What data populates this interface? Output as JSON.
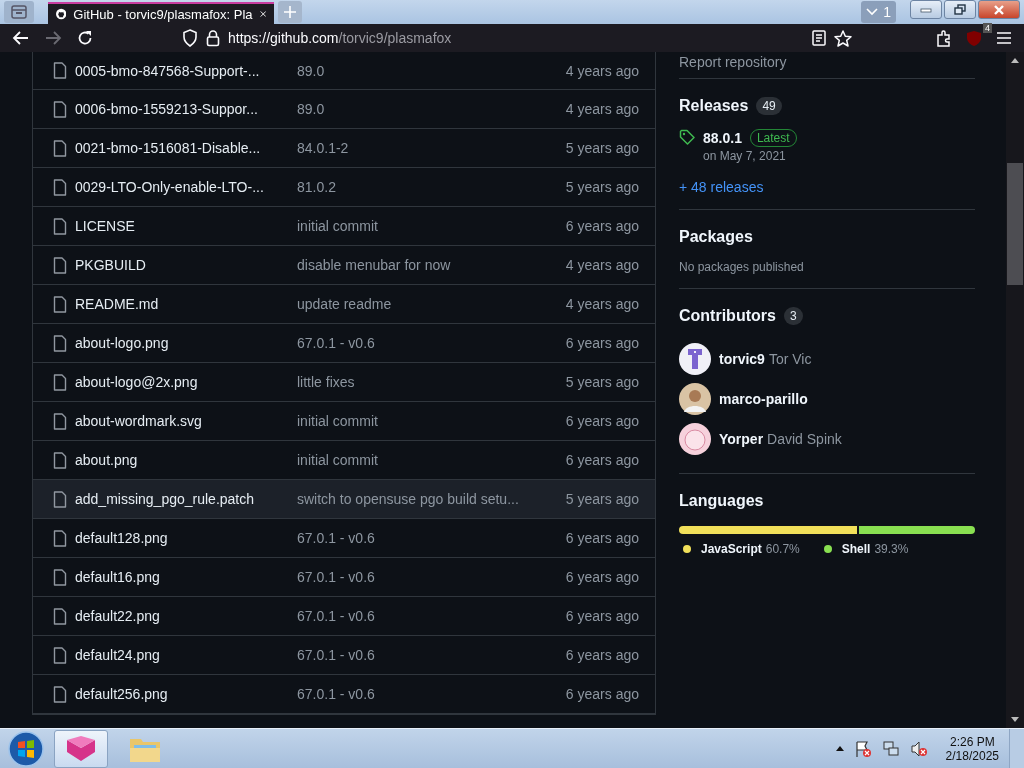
{
  "browser": {
    "tab": {
      "title": "GitHub - torvic9/plasmafox: Pla",
      "selected": true
    },
    "tab_count": "1",
    "url": {
      "domain": "https://github.com",
      "path": "/torvic9/plasmafox"
    },
    "forward_disabled": true,
    "extension_badge": "4"
  },
  "files": [
    {
      "name": "0005-bmo-847568-Support-...",
      "message": "89.0",
      "age": "4 years ago",
      "hovered": false
    },
    {
      "name": "0006-bmo-1559213-Suppor...",
      "message": "89.0",
      "age": "4 years ago",
      "hovered": false
    },
    {
      "name": "0021-bmo-1516081-Disable...",
      "message": "84.0.1-2",
      "age": "5 years ago",
      "hovered": false
    },
    {
      "name": "0029-LTO-Only-enable-LTO-...",
      "message": "81.0.2",
      "age": "5 years ago",
      "hovered": false
    },
    {
      "name": "LICENSE",
      "message": "initial commit",
      "age": "6 years ago",
      "hovered": false
    },
    {
      "name": "PKGBUILD",
      "message": "disable menubar for now",
      "age": "4 years ago",
      "hovered": false
    },
    {
      "name": "README.md",
      "message": "update readme",
      "age": "4 years ago",
      "hovered": false
    },
    {
      "name": "about-logo.png",
      "message": "67.0.1 - v0.6",
      "age": "6 years ago",
      "hovered": false
    },
    {
      "name": "about-logo@2x.png",
      "message": "little fixes",
      "age": "5 years ago",
      "hovered": false
    },
    {
      "name": "about-wordmark.svg",
      "message": "initial commit",
      "age": "6 years ago",
      "hovered": false
    },
    {
      "name": "about.png",
      "message": "initial commit",
      "age": "6 years ago",
      "hovered": false
    },
    {
      "name": "add_missing_pgo_rule.patch",
      "message": "switch to opensuse pgo build setu...",
      "age": "5 years ago",
      "hovered": true
    },
    {
      "name": "default128.png",
      "message": "67.0.1 - v0.6",
      "age": "6 years ago",
      "hovered": false
    },
    {
      "name": "default16.png",
      "message": "67.0.1 - v0.6",
      "age": "6 years ago",
      "hovered": false
    },
    {
      "name": "default22.png",
      "message": "67.0.1 - v0.6",
      "age": "6 years ago",
      "hovered": false
    },
    {
      "name": "default24.png",
      "message": "67.0.1 - v0.6",
      "age": "6 years ago",
      "hovered": false
    },
    {
      "name": "default256.png",
      "message": "67.0.1 - v0.6",
      "age": "6 years ago",
      "hovered": false
    }
  ],
  "sidebar": {
    "report_link": "Report repository",
    "releases": {
      "title": "Releases",
      "count": "49",
      "latest": {
        "version": "88.0.1",
        "badge": "Latest",
        "date": "on May 7, 2021"
      },
      "more": "+ 48 releases"
    },
    "packages": {
      "title": "Packages",
      "empty": "No packages published"
    },
    "contributors": {
      "title": "Contributors",
      "count": "3",
      "people": [
        {
          "login": "torvic9",
          "name": "Tor Vic",
          "kind": "pattern"
        },
        {
          "login": "marco-parillo",
          "kind": "photo"
        },
        {
          "login": "Yorper",
          "name": "David Spink",
          "kind": "drawing"
        }
      ]
    },
    "languages": {
      "title": "Languages",
      "items": [
        {
          "name": "JavaScript",
          "percent": "60.7%",
          "color": "#f1e05a"
        },
        {
          "name": "Shell",
          "percent": "39.3%",
          "color": "#89e051"
        }
      ]
    }
  },
  "taskbar": {
    "time": "2:26 PM",
    "date": "2/18/2025"
  }
}
